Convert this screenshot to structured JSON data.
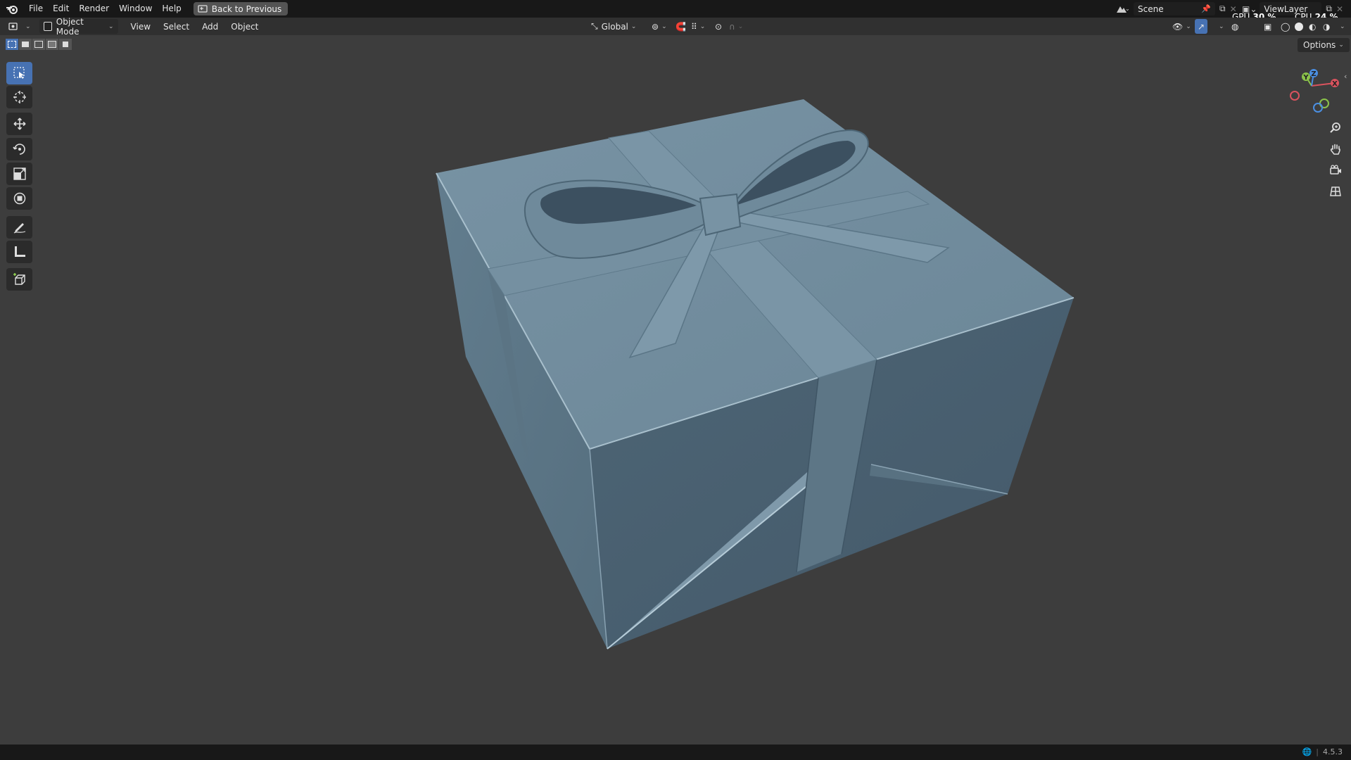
{
  "menubar": {
    "items": [
      "File",
      "Edit",
      "Render",
      "Window",
      "Help"
    ],
    "back_label": "Back to Previous"
  },
  "scene": {
    "label": "Scene"
  },
  "viewlayer": {
    "label": "ViewLayer"
  },
  "stats": {
    "gpu_label": "GPU",
    "gpu_value": "30 %",
    "cpu_label": "CPU",
    "cpu_value": "24 %"
  },
  "header": {
    "mode_label": "Object Mode",
    "menus": [
      "View",
      "Select",
      "Add",
      "Object"
    ],
    "orientation_label": "Global"
  },
  "viewport": {
    "options_label": "Options",
    "gizmo_axes": {
      "x": "X",
      "y": "Y",
      "z": "Z"
    }
  },
  "status": {
    "version": "4.5.3"
  },
  "colors": {
    "accent": "#4772b3",
    "viewport_bg": "#3d3d3d",
    "model_top": "#6f8a9b",
    "model_left": "#5a7384",
    "model_right": "#4a6170"
  }
}
